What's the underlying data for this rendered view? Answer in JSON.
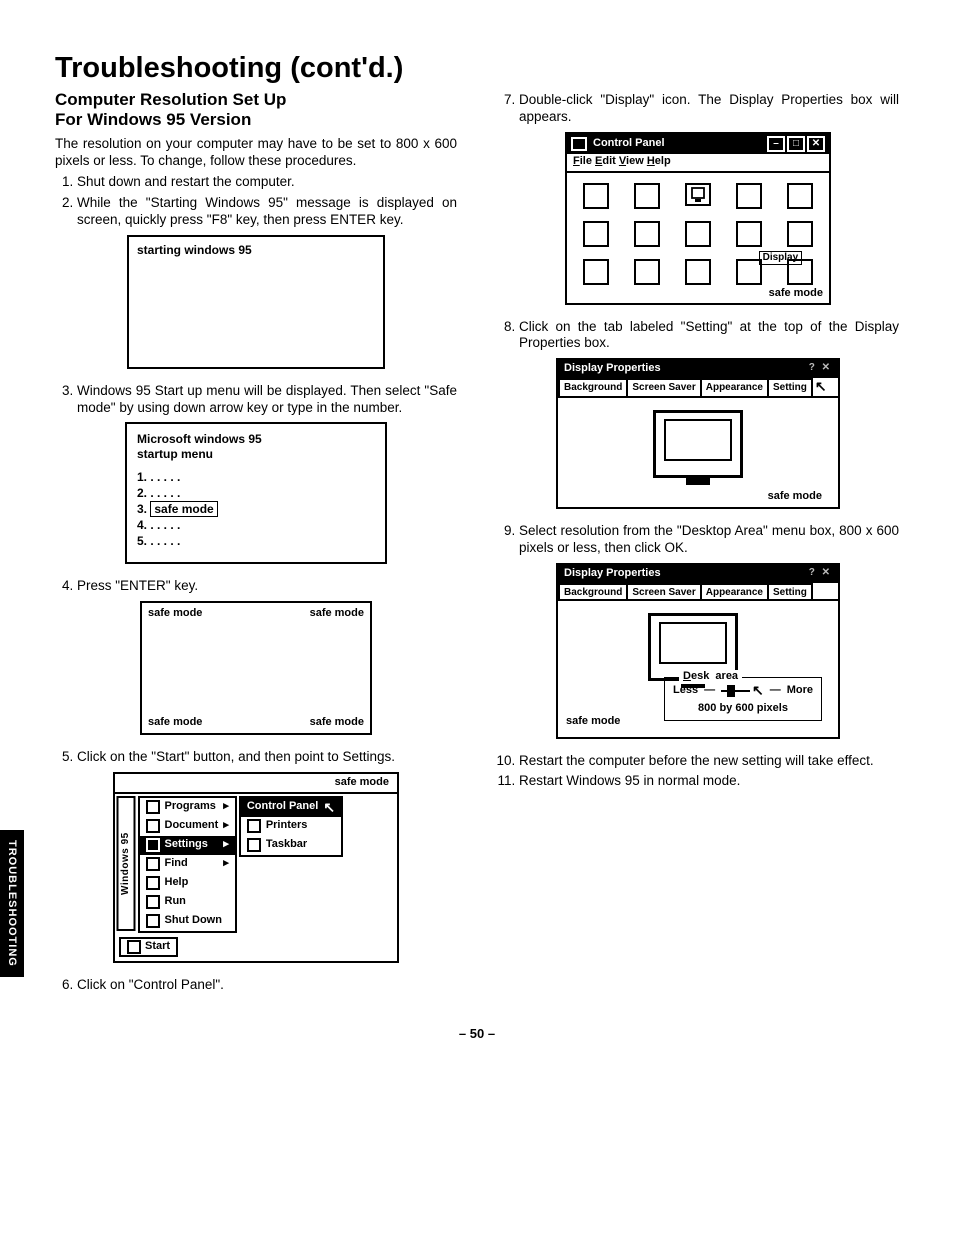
{
  "title": "Troubleshooting (cont'd.)",
  "subtitle_line1": "Computer Resolution Set Up",
  "subtitle_line2": "For Windows 95 Version",
  "intro": "The resolution on your computer may have to be set to 800 x 600 pixels or less. To change, follow these procedures.",
  "steps": {
    "s1": "Shut down and restart the computer.",
    "s2": "While the \"Starting Windows 95\" message is displayed on screen, quickly press \"F8\" key, then press ENTER key.",
    "s3": "Windows 95 Start up menu will be displayed. Then select \"Safe mode\" by using down arrow key or type in the number.",
    "s4": "Press \"ENTER\" key.",
    "s5": "Click on the \"Start\" button, and then point to Settings.",
    "s6": "Click on \"Control Panel\".",
    "s7": "Double-click \"Display\" icon. The Display Properties box will appears.",
    "s8": "Click on the tab labeled \"Setting\" at the top of the Display Properties box.",
    "s9": "Select resolution from the \"Desktop Area\" menu box, 800 x 600 pixels or less, then click OK.",
    "s10": "Restart the computer before the new setting will take effect.",
    "s11": "Restart Windows 95 in normal mode."
  },
  "fig_start": {
    "text": "starting windows 95"
  },
  "fig_menu": {
    "title1": "Microsoft windows 95",
    "title2": "startup menu",
    "opts": [
      "1. . . . . .",
      "2. . . . . .",
      "3.",
      "4. . . . . .",
      "5. . . . . ."
    ],
    "safe": "safe mode"
  },
  "safe_corner": "safe mode",
  "startmenu": {
    "status": "safe mode",
    "winbar": "Windows 95",
    "items": {
      "programs": "Programs",
      "document": "Document",
      "settings": "Settings",
      "find": "Find",
      "help": "Help",
      "run": "Run",
      "shutdown": "Shut Down"
    },
    "sub": {
      "cp": "Control Panel",
      "printers": "Printers",
      "taskbar": "Taskbar"
    },
    "start": "Start"
  },
  "cp": {
    "title": "Control Panel",
    "menu": {
      "file": "File",
      "edit": "Edit",
      "view": "View",
      "help": "Help"
    },
    "display": "Display",
    "status": "safe mode"
  },
  "dp": {
    "title": "Display Properties",
    "tabs": {
      "bg": "Background",
      "ss": "Screen Saver",
      "ap": "Appearance",
      "st": "Setting"
    },
    "status": "safe mode",
    "desk_legend": "Desk  area",
    "less": "Less",
    "more": "More",
    "res": "800 by 600 pixels",
    "safe_left": "safe mode"
  },
  "sidetab": "TROUBLESHOOTING",
  "pageno": "– 50 –"
}
